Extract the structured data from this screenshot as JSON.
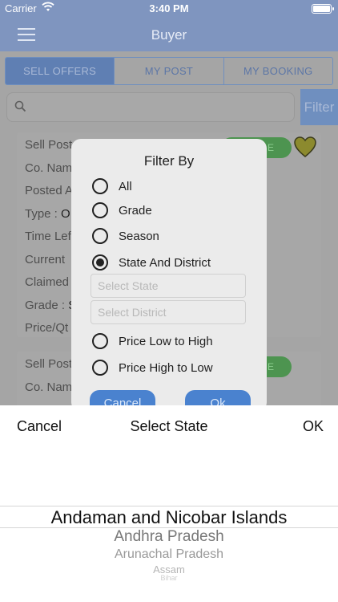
{
  "status": {
    "carrier": "Carrier",
    "time": "3:40 PM"
  },
  "nav": {
    "title": "Buyer"
  },
  "tabs": [
    "SELL OFFERS",
    "MY POST",
    "MY BOOKING"
  ],
  "search": {
    "placeholder": ""
  },
  "filter_button": "Filter",
  "cards": [
    {
      "rows": [
        {
          "label": "Sell Post",
          "value": ""
        },
        {
          "label": "Co. Nam",
          "value": ""
        },
        {
          "label": "Posted A",
          "value": ""
        },
        {
          "label": "Type : ",
          "value": "O"
        },
        {
          "label": "Time Lef",
          "value": ""
        },
        {
          "label": "Current",
          "value": ""
        },
        {
          "label": "Claimed",
          "value": ""
        },
        {
          "label": "Grade : ",
          "value": "S"
        },
        {
          "label": "Price/Qt",
          "value": ""
        }
      ],
      "badge": "E"
    },
    {
      "rows": [
        {
          "label": "Sell Post",
          "value": ""
        },
        {
          "label": "Co. Nam",
          "value": ""
        }
      ],
      "badge": "E"
    }
  ],
  "modal": {
    "title": "Filter By",
    "options": [
      "All",
      "Grade",
      "Season",
      "State And District",
      "Price Low to High",
      "Price High to Low"
    ],
    "selected": "State And District",
    "state_placeholder": "Select State",
    "district_placeholder": "Select District",
    "cancel": "Cancel",
    "ok": "Ok"
  },
  "picker": {
    "cancel": "Cancel",
    "title": "Select State",
    "ok": "OK",
    "items": [
      "Andaman and Nicobar Islands",
      "Andhra Pradesh",
      "Arunachal Pradesh",
      "Assam",
      "Bihar"
    ]
  }
}
